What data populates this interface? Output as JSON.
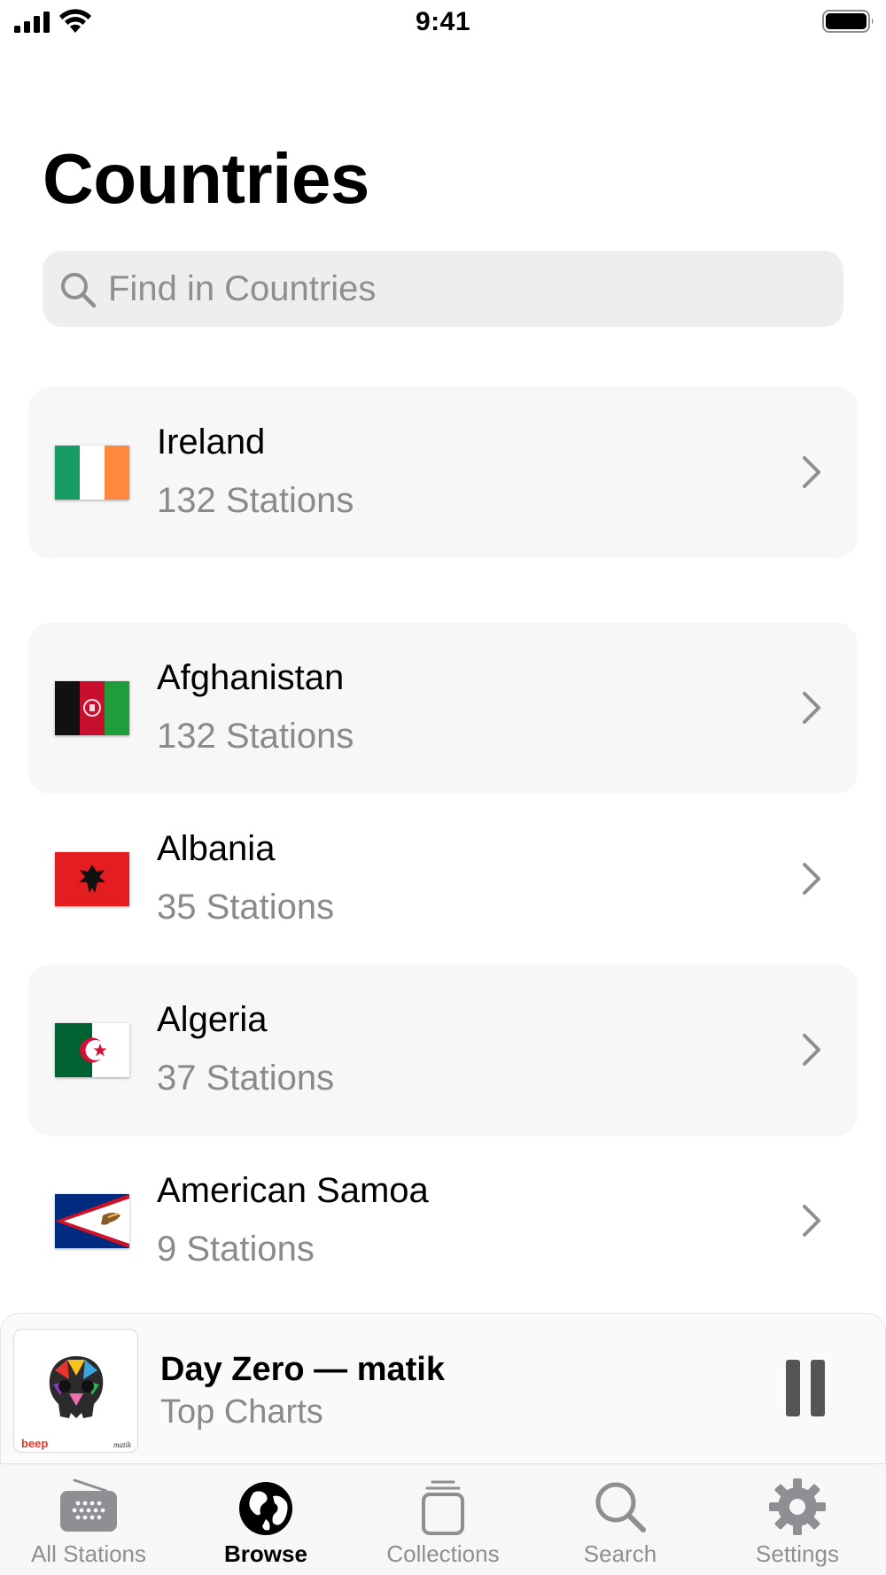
{
  "status_bar": {
    "time": "9:41"
  },
  "header": {
    "title": "Countries"
  },
  "search": {
    "placeholder": "Find in Countries"
  },
  "featured": {
    "name": "Ireland",
    "count": "132 Stations",
    "flag": "ireland-flag"
  },
  "countries": [
    {
      "name": "Afghanistan",
      "count": "132 Stations",
      "flag": "afghanistan-flag"
    },
    {
      "name": "Albania",
      "count": "35 Stations",
      "flag": "albania-flag"
    },
    {
      "name": "Algeria",
      "count": "37 Stations",
      "flag": "algeria-flag"
    },
    {
      "name": "American Samoa",
      "count": "9 Stations",
      "flag": "american-samoa-flag"
    }
  ],
  "now_playing": {
    "title": "Day Zero — matik",
    "subtitle": "Top Charts",
    "artwork_text": "beep",
    "artwork_signature": "matik"
  },
  "tabs": [
    {
      "label": "All Stations",
      "icon": "radio-icon"
    },
    {
      "label": "Browse",
      "icon": "globe-icon"
    },
    {
      "label": "Collections",
      "icon": "collections-icon"
    },
    {
      "label": "Search",
      "icon": "search-icon"
    },
    {
      "label": "Settings",
      "icon": "gear-icon"
    }
  ],
  "colors": {
    "selected_tab": "#000000",
    "unselected_tab": "#8e8e93",
    "row_shade": "#f7f7f7",
    "secondary_text": "#8a8a8e"
  }
}
